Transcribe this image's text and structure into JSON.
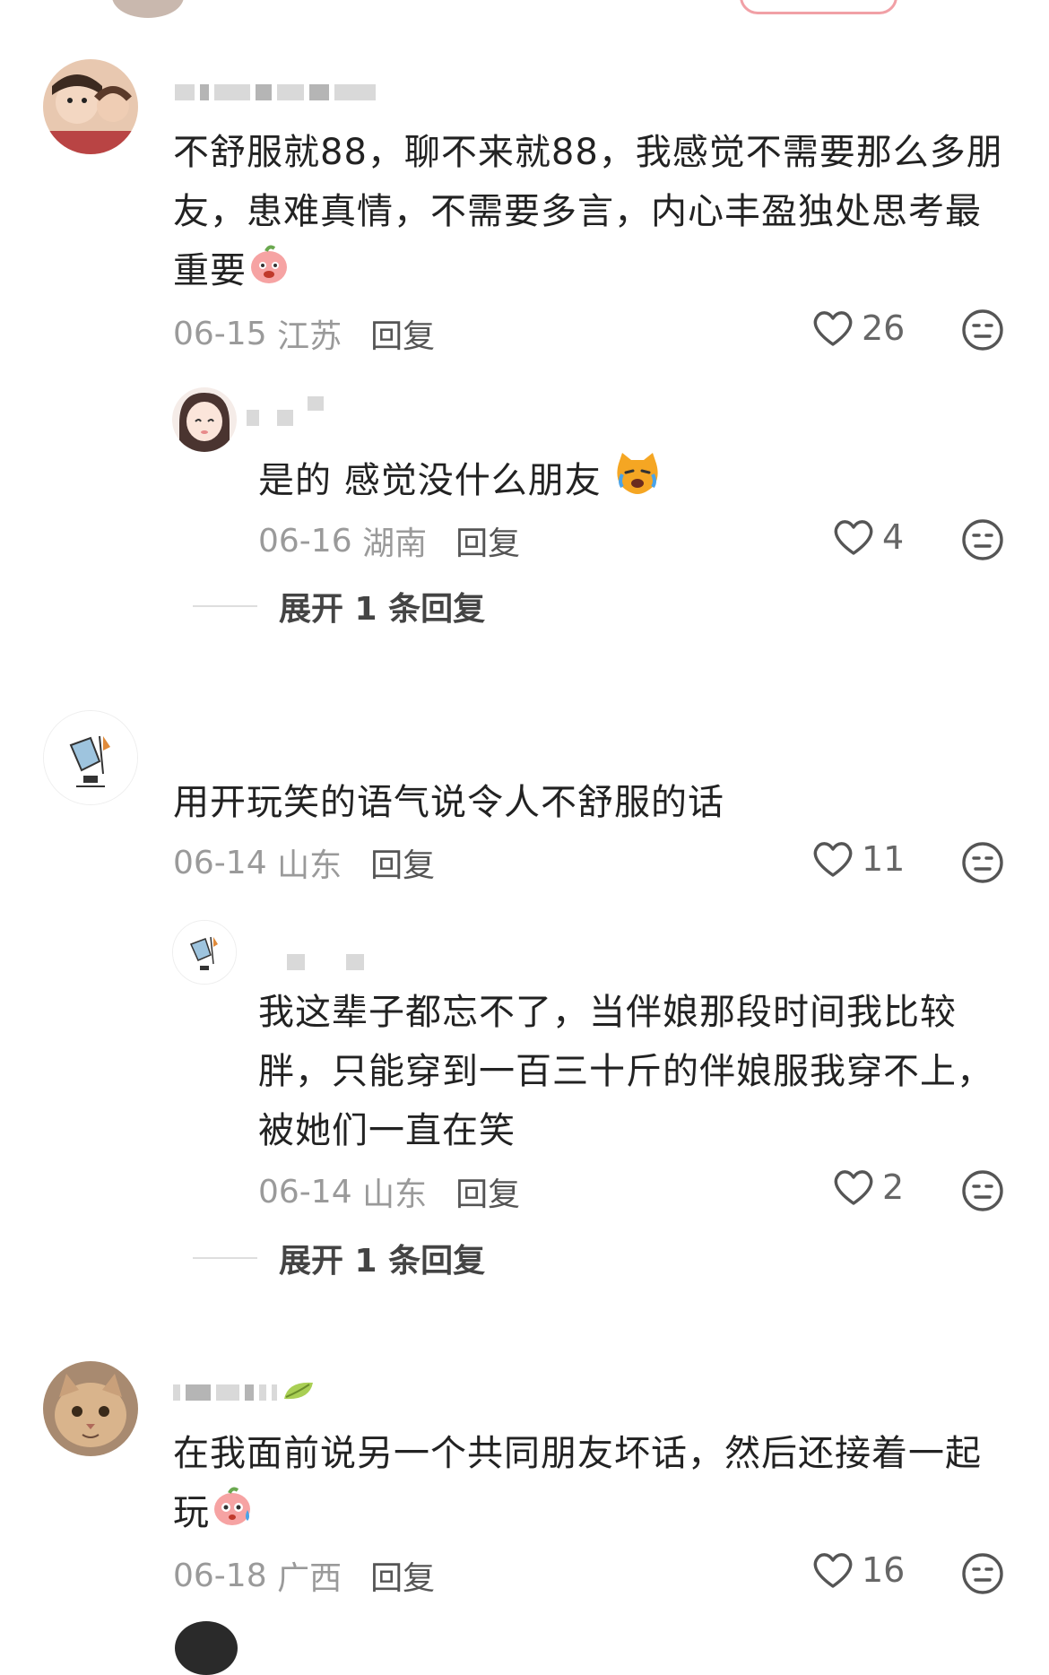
{
  "comments": [
    {
      "text": "不舒服就88，聊不来就88，我感觉不需要那么多朋友，患难真情，不需要多言，内心丰盈独处思考最重要",
      "emoji": "peach-face-emoji",
      "date": "06-15",
      "location": "江苏",
      "reply_label": "回复",
      "likes": "26"
    },
    {
      "text": "是的 感觉没什么朋友",
      "emoji": "crying-cat-emoji",
      "date": "06-16",
      "location": "湖南",
      "reply_label": "回复",
      "likes": "4",
      "expand_label": "展开 1 条回复"
    },
    {
      "text": "用开玩笑的语气说令人不舒服的话",
      "date": "06-14",
      "location": "山东",
      "reply_label": "回复",
      "likes": "11"
    },
    {
      "text": "我这辈子都忘不了，当伴娘那段时间我比较胖，只能穿到一百三十斤的伴娘服我穿不上，被她们一直在笑",
      "date": "06-14",
      "location": "山东",
      "reply_label": "回复",
      "likes": "2",
      "expand_label": "展开 1 条回复"
    },
    {
      "text": "在我面前说另一个共同朋友坏话，然后还接着一起玩",
      "emoji": "peach-sweat-emoji",
      "date": "06-18",
      "location": "广西",
      "reply_label": "回复",
      "likes": "16"
    }
  ],
  "icons": {
    "like": "heart-outline-icon",
    "dislike": "neutral-face-icon"
  },
  "colors": {
    "text": "#222222",
    "meta": "#9a9a9a",
    "reply": "#555555"
  }
}
